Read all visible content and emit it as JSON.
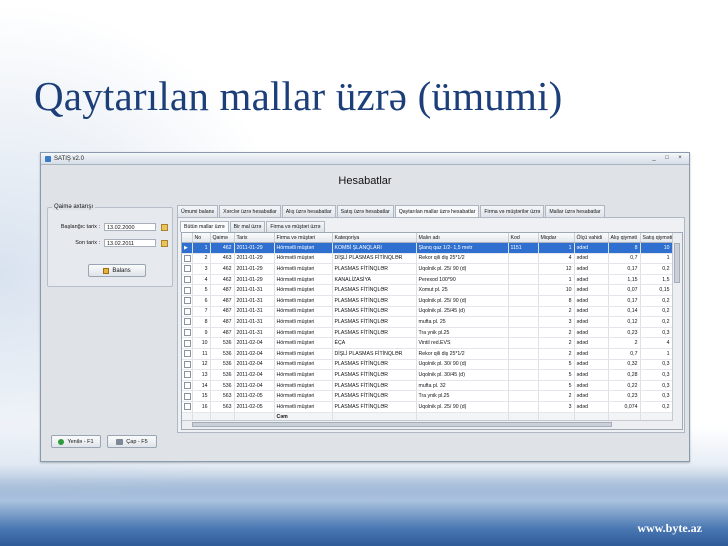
{
  "slide": {
    "title": "Qaytarılan mallar üzrə (ümumi)",
    "watermark": "www.byte.az"
  },
  "window": {
    "title": "SATIŞ v2.0",
    "controls": [
      "_",
      "□",
      "×"
    ],
    "header": "Hesabatlar"
  },
  "filters": {
    "group_title": "Qaimə axtarışı",
    "start_label": "Başlanğıc tarix :",
    "start_value": "13.02.2000",
    "end_label": "Son tarix :",
    "end_value": "13.02.2011",
    "balans_label": "Balans"
  },
  "buttons": {
    "refresh": "Yenilə - F1",
    "print": "Çap - F5"
  },
  "tabs": [
    "Ümumi balans",
    "Xərclər üzrə hesabatlar",
    "Alış üzrə hesabatlar",
    "Satış üzrə hesabatlar",
    "Qaytarılan mallar üzrə hesabatlar",
    "Firma və müştərilər üzrə",
    "Mallar üzrə hesabatlar"
  ],
  "subtabs": [
    "Bütün mallar üzrə",
    "Bir mal üzrə",
    "Firma və müştəri üzrə"
  ],
  "table": {
    "columns": [
      "",
      "No",
      "Qaimə",
      "Tarix",
      "Firma və müştəri",
      "Kateqoriya",
      "Malın adı",
      "Kod",
      "Miqdar",
      "Ölçü vahidi",
      "Alış qiyməti",
      "Satış qiyməti"
    ],
    "rows": [
      [
        "▶",
        "1",
        "462",
        "2011-01-29",
        "Hörmətli müştəri",
        "KOMBİ ŞLANQLARI",
        "Şlanq qaz 1/2- 1,5 metr",
        "1151",
        "1",
        "ədəd",
        "8",
        "10"
      ],
      [
        "",
        "2",
        "463",
        "2011-01-29",
        "Hörmətli müştəri",
        "DİŞLİ PLASMAS FİTİNQLƏR",
        "Rekor qili diş 25*1/2",
        "",
        "4",
        "ədəd",
        "0,7",
        "1"
      ],
      [
        "",
        "3",
        "462",
        "2011-01-29",
        "Hörmətli müştəri",
        "PLASMAS FİTİNQLƏR",
        "Uqolnik pl. 25/ 90 (d)",
        "",
        "12",
        "ədəd",
        "0,17",
        "0,2"
      ],
      [
        "",
        "4",
        "462",
        "2011-01-29",
        "Hörmətli müştəri",
        "KANALİZASİYA",
        "Perexod 100*90",
        "",
        "1",
        "ədəd",
        "1,15",
        "1,5"
      ],
      [
        "",
        "5",
        "487",
        "2011-01-31",
        "Hörmətli müştəri",
        "PLASMAS FİTİNQLƏR",
        "Xomut pl. 25",
        "",
        "10",
        "ədəd",
        "0,07",
        "0,15"
      ],
      [
        "",
        "6",
        "487",
        "2011-01-31",
        "Hörmətli müştəri",
        "PLASMAS FİTİNQLƏR",
        "Uqolnik pl. 25/ 90 (d)",
        "",
        "8",
        "ədəd",
        "0,17",
        "0,2"
      ],
      [
        "",
        "7",
        "487",
        "2011-01-31",
        "Hörmətli müştəri",
        "PLASMAS FİTİNQLƏR",
        "Uqolnik pl. 25/45 (d)",
        "",
        "2",
        "ədəd",
        "0,14",
        "0,2"
      ],
      [
        "",
        "8",
        "487",
        "2011-01-31",
        "Hörmətli müştəri",
        "PLASMAS FİTİNQLƏR",
        "mufta pl. 25",
        "",
        "3",
        "ədəd",
        "0,12",
        "0,2"
      ],
      [
        "",
        "9",
        "487",
        "2011-01-31",
        "Hörmətli müştəri",
        "PLASMAS FİTİNQLƏR",
        "Tra ynik pl.25",
        "",
        "2",
        "ədəd",
        "0,23",
        "0,3"
      ],
      [
        "",
        "10",
        "536",
        "2011-02-04",
        "Hörmətli müştəri",
        "ÉÇA",
        "Vintil red.EVS",
        "",
        "2",
        "ədəd",
        "2",
        "4"
      ],
      [
        "",
        "11",
        "536",
        "2011-02-04",
        "Hörmətli müştəri",
        "DİŞLİ PLASMAS FİTİNQLƏR",
        "Rekor qili diş 25*1/2",
        "",
        "2",
        "ədəd",
        "0,7",
        "1"
      ],
      [
        "",
        "12",
        "536",
        "2011-02-04",
        "Hörmətli müştəri",
        "PLASMAS FİTİNQLƏR",
        "Uqolnik pl. 30/ 90 (d)",
        "",
        "5",
        "ədəd",
        "0,32",
        "0,3"
      ],
      [
        "",
        "13",
        "536",
        "2011-02-04",
        "Hörmətli müştəri",
        "PLASMAS FİTİNQLƏR",
        "Uqolnik pl. 30/45 (d)",
        "",
        "5",
        "ədəd",
        "0,28",
        "0,3"
      ],
      [
        "",
        "14",
        "536",
        "2011-02-04",
        "Hörmətli müştəri",
        "PLASMAS FİTİNQLƏR",
        "mufta pl. 32",
        "",
        "5",
        "ədəd",
        "0,22",
        "0,3"
      ],
      [
        "",
        "15",
        "563",
        "2011-02-05",
        "Hörmətli müştəri",
        "PLASMAS FİTİNQLƏR",
        "Tra ynik pl.25",
        "",
        "2",
        "ədəd",
        "0,23",
        "0,3"
      ],
      [
        "",
        "16",
        "563",
        "2011-02-05",
        "Hörmətli müştəri",
        "PLASMAS FİTİNQLƏR",
        "Uqolnik pl. 25/ 90 (d)",
        "",
        "3",
        "ədəd",
        "0,074",
        "0,2"
      ]
    ],
    "total_label": "Cəm"
  }
}
